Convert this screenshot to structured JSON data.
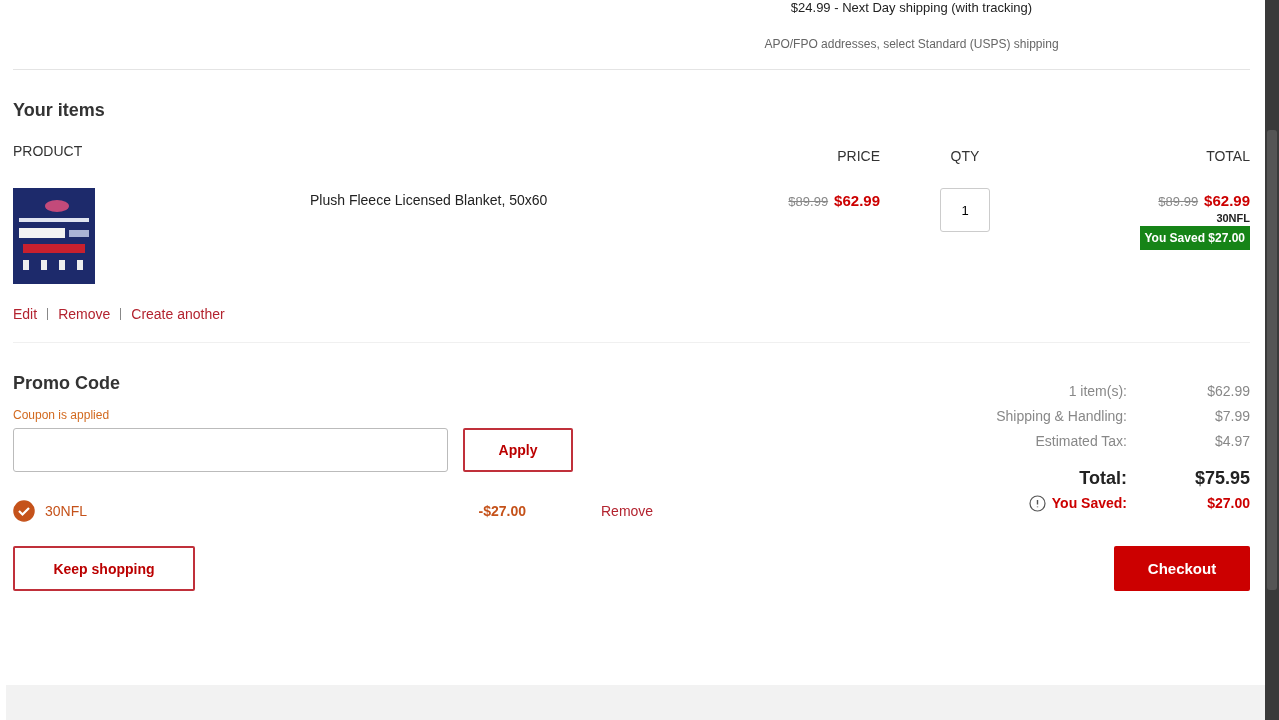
{
  "shipping": {
    "option": "$24.99 - Next Day shipping (with tracking)",
    "note": "APO/FPO addresses, select Standard (USPS) shipping"
  },
  "items": {
    "title": "Your items",
    "columns": {
      "product": "PRODUCT",
      "price": "PRICE",
      "qty": "QTY",
      "total": "TOTAL"
    },
    "rows": [
      {
        "name": "Plush Fleece Licensed Blanket, 50x60",
        "old_price": "$89.99",
        "price": "$62.99",
        "qty": "1",
        "old_total": "$89.99",
        "total": "$62.99",
        "code": "30NFL",
        "saved": "You Saved $27.00",
        "actions": [
          "Edit",
          "Remove",
          "Create another"
        ]
      }
    ]
  },
  "promo": {
    "title": "Promo Code",
    "status": "Coupon is applied",
    "apply": "Apply",
    "coupons": [
      {
        "code": "30NFL",
        "applied": true,
        "amount": "-$27.00",
        "remove": "Remove"
      }
    ]
  },
  "summary": {
    "lines": [
      {
        "label": "1 item(s):",
        "value": "$62.99"
      },
      {
        "label": "Shipping & Handling:",
        "value": "$7.99"
      },
      {
        "label": "Estimated Tax:",
        "value": "$4.97"
      }
    ],
    "total": {
      "label": "Total:",
      "value": "$75.95"
    },
    "saved": {
      "label": "You Saved:",
      "value": "$27.00"
    }
  },
  "buttons": {
    "keep": "Keep shopping",
    "checkout": "Checkout"
  }
}
